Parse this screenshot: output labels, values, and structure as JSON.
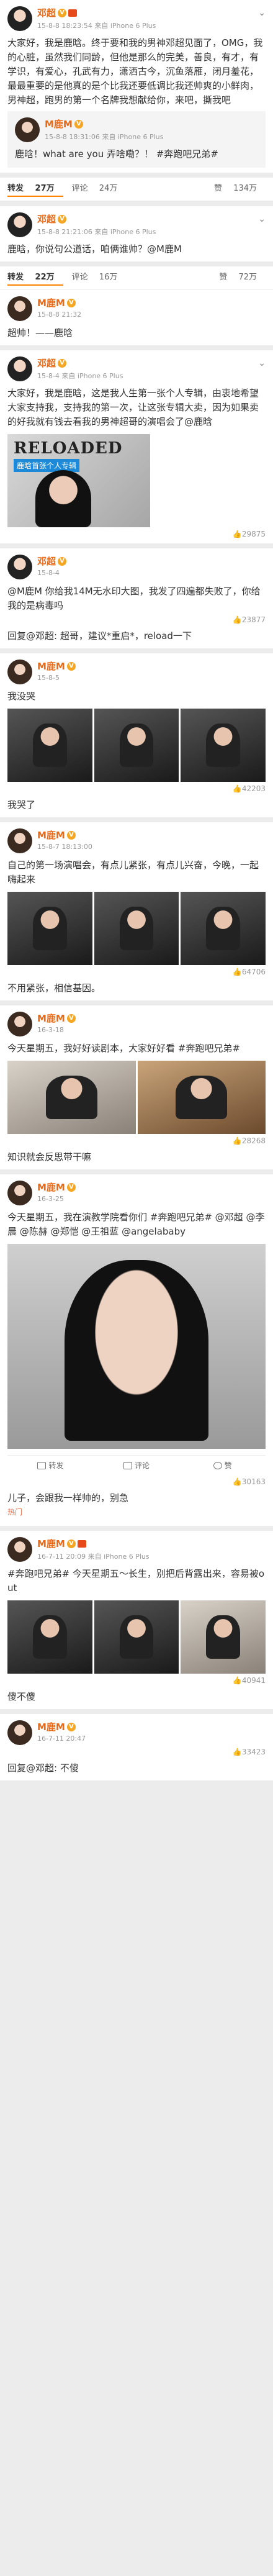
{
  "posts": [
    {
      "user": "邓超",
      "time": "15-8-8 18:23:54 来自 iPhone 6 Plus",
      "text": "大家好，我是鹿晗。终于要和我的男神邓超见面了，OMG，我的心脏，虽然我们同龄，但他是那么的完美，善良，有才，有学识，有爱心，孔武有力，潇洒古今，沉鱼落雁，闭月羞花，最最重要的是他真的是个比我还要低调比我还帅爽的小鲜肉，男神超，跑男的第一个名牌我想献给你，来吧，撕我吧",
      "reposts": "27万",
      "comments": "24万",
      "likes": "134万",
      "reply": {
        "user": "M鹿M",
        "time": "15-8-8 18:31:06 来自 iPhone 6 Plus",
        "text": "鹿晗！what are you 弄啥嘞？！ #奔跑吧兄弟#"
      }
    },
    {
      "user": "邓超",
      "time": "15-8-8 21:21:06 来自 iPhone 6 Plus",
      "text": "鹿晗，你说句公道话，咱俩谁帅？@M鹿M",
      "reposts": "22万",
      "comments": "16万",
      "likes": "72万",
      "reply": {
        "user": "M鹿M",
        "time": "15-8-8 21:32",
        "text": "超帅！——鹿晗"
      }
    },
    {
      "user": "邓超",
      "time": "15-8-4 来自 iPhone 6 Plus",
      "text": "大家好，我是鹿晗，这是我人生第一张个人专辑，由衷地希望大家支持我，支持我的第一次，让这张专辑大卖，因为如果卖的好我就有钱去看我的男神超哥的演唱会了@鹿晗",
      "poster_title": "RELOADED",
      "poster_band": "鹿晗首张个人专辑",
      "stat": "29875"
    },
    {
      "user": "邓超",
      "time": "15-8-4",
      "text": "@M鹿M 你给我14M无水印大图，我发了四遍都失败了，你给我的是病毒吗",
      "stat": "23877",
      "reply": "回复@邓超: 超哥，建议*重启*，reload一下"
    },
    {
      "user": "M鹿M",
      "time": "15-8-5",
      "text": "我没哭",
      "stat": "42203",
      "reply": "我哭了"
    },
    {
      "user": "M鹿M",
      "time": "15-8-7 18:13:00",
      "text": "自己的第一场演唱会，有点儿紧张，有点儿兴奋，今晚，一起嗨起来",
      "stat": "64706",
      "reply": "不用紧张，相信基因。"
    },
    {
      "user": "M鹿M",
      "time": "16-3-18",
      "text": "今天星期五，我好好读剧本，大家好好看 #奔跑吧兄弟#",
      "stat": "28268",
      "reply": "知识就会反思带干嘛"
    },
    {
      "user": "M鹿M",
      "time": "16-3-25",
      "text": "今天星期五，我在演教学院看你们 #奔跑吧兄弟# @邓超 @李晨 @陈赫 @郑恺 @王祖蓝 @angelababy",
      "actions": [
        "转发",
        "评论",
        "赞"
      ],
      "stat": "30163",
      "reply": "儿子，会跟我一样帅的，别急",
      "hot": "热门"
    },
    {
      "user": "M鹿M",
      "time": "16-7-11 20:09 来自 iPhone 6 Plus",
      "text": "#奔跑吧兄弟# 今天星期五～长生，别把后背露出来，容易被out",
      "stat": "40941",
      "reply": "傻不傻"
    },
    {
      "user": "M鹿M",
      "time": "16-7-11 20:47",
      "stat": "33423",
      "reply": "回复@邓超: 不傻"
    }
  ],
  "tabs": {
    "reposts": "转发",
    "comments": "评论",
    "likes": "赞"
  },
  "colors": {
    "name": "#e86b1a",
    "tag": "#eb7350",
    "accent": "#ff8200"
  }
}
